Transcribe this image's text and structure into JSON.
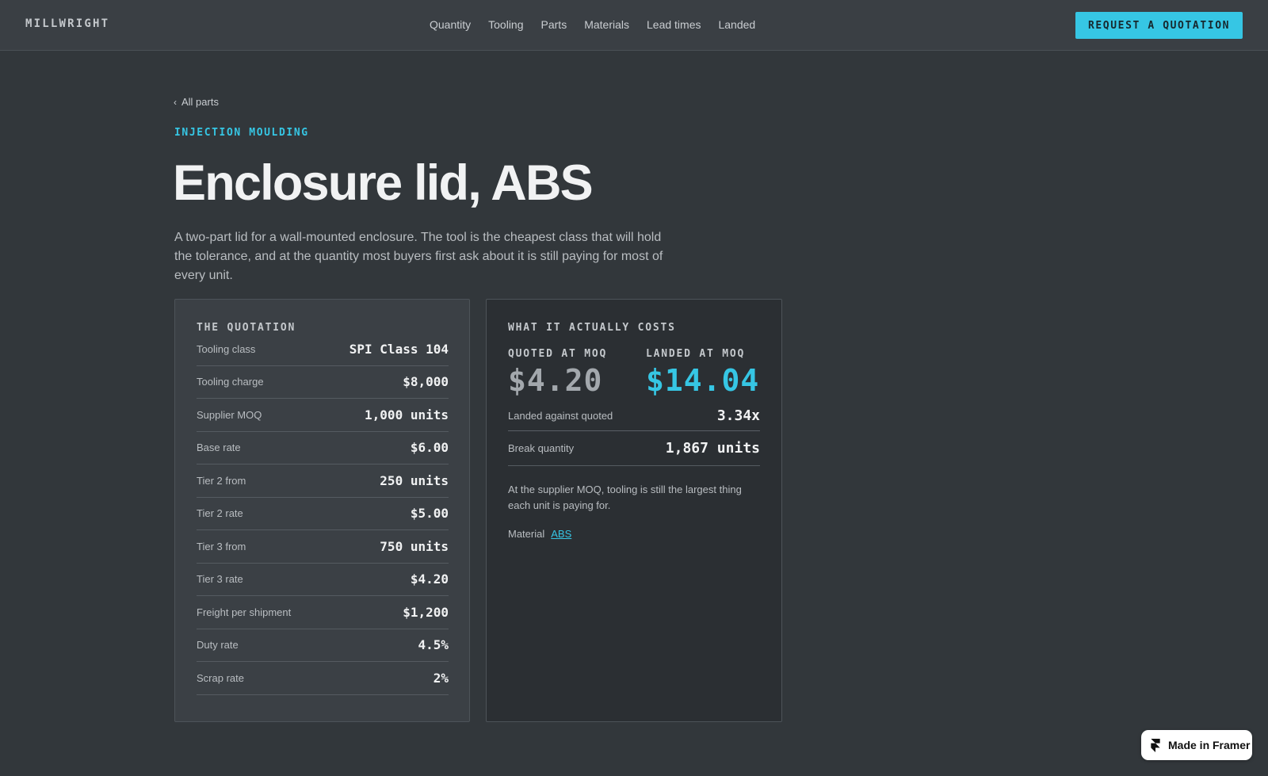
{
  "brand": {
    "logo": "MILLWRIGHT"
  },
  "nav": {
    "items": [
      {
        "label": "Quantity"
      },
      {
        "label": "Tooling"
      },
      {
        "label": "Parts"
      },
      {
        "label": "Materials"
      },
      {
        "label": "Lead times"
      },
      {
        "label": "Landed"
      }
    ],
    "cta": "REQUEST A QUOTATION"
  },
  "breadcrumb": {
    "icon": "chevron-left-icon",
    "label": "All parts"
  },
  "part": {
    "category": "INJECTION MOULDING",
    "title": "Enclosure lid, ABS",
    "description": "A two-part lid for a wall-mounted enclosure. The tool is the cheapest class that will hold the tolerance, and at the quantity most buyers first ask about it is still paying for most of every unit."
  },
  "quotation": {
    "heading": "THE QUOTATION",
    "rows": [
      {
        "label": "Tooling class",
        "value": "SPI Class 104"
      },
      {
        "label": "Tooling charge",
        "value": "$8,000"
      },
      {
        "label": "Supplier MOQ",
        "value": "1,000 units"
      },
      {
        "label": "Base rate",
        "value": "$6.00"
      },
      {
        "label": "Tier 2 from",
        "value": "250 units"
      },
      {
        "label": "Tier 2 rate",
        "value": "$5.00"
      },
      {
        "label": "Tier 3 from",
        "value": "750 units"
      },
      {
        "label": "Tier 3 rate",
        "value": "$4.20"
      },
      {
        "label": "Freight per shipment",
        "value": "$1,200"
      },
      {
        "label": "Duty rate",
        "value": "4.5%"
      },
      {
        "label": "Scrap rate",
        "value": "2%"
      }
    ]
  },
  "costs": {
    "heading": "WHAT IT ACTUALLY COSTS",
    "quoted_label": "QUOTED AT MOQ",
    "quoted_value": "$4.20",
    "landed_label": "LANDED AT MOQ",
    "landed_value": "$14.04",
    "rows": [
      {
        "label": "Landed against quoted",
        "value": "3.34x"
      },
      {
        "label": "Break quantity",
        "value": "1,867 units"
      }
    ],
    "note": "At the supplier MOQ, tooling is still the largest thing each unit is paying for.",
    "material_label": "Material",
    "material_value": "ABS"
  },
  "badge": {
    "label": "Made in Framer",
    "icon": "framer-logo-icon"
  },
  "colors": {
    "background": "#32373b",
    "header": "#3a3f44",
    "accent": "#36c6e4",
    "card_light": "#3b4045",
    "card_dark": "#2b2f33"
  }
}
